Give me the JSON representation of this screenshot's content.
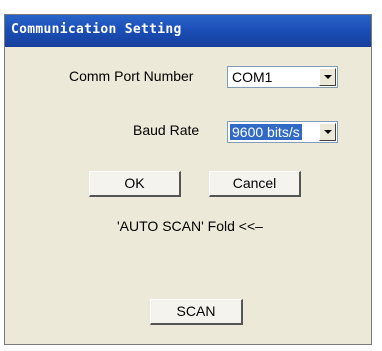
{
  "window": {
    "title": "Communication Setting"
  },
  "comm_port": {
    "label": "Comm Port Number",
    "selected": "COM1"
  },
  "baud_rate": {
    "label": "Baud Rate",
    "selected": "9600 bits/s"
  },
  "buttons": {
    "ok": "OK",
    "cancel": "Cancel",
    "scan": "SCAN"
  },
  "auto_scan": {
    "text": "'AUTO SCAN' Fold <<–"
  },
  "colors": {
    "title_bar": "#1b4fb8",
    "dialog_bg": "#ece9d8",
    "selection": "#316ac5"
  }
}
